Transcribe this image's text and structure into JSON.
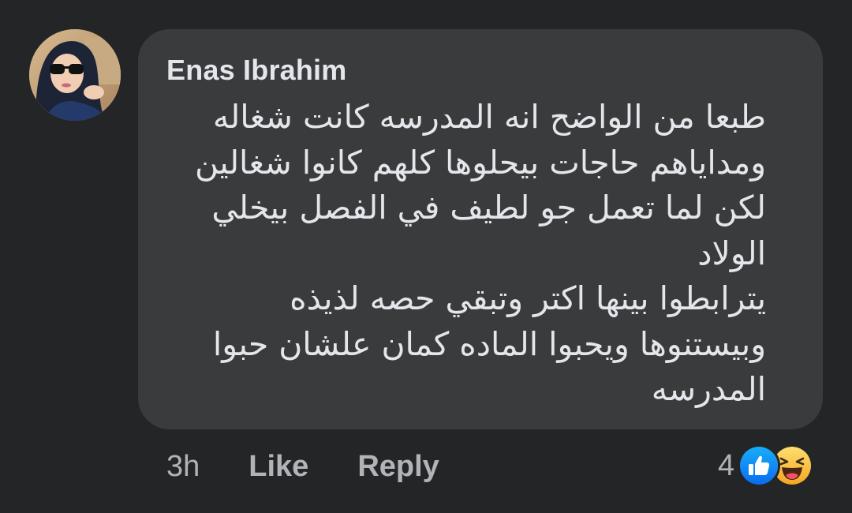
{
  "comment": {
    "author": "Enas Ibrahim",
    "text_lines": [
      "طبعا من الواضح انه المدرسه كانت شغاله",
      "ومداياهم حاجات بيحلوها كلهم كانوا شغالين",
      "لكن لما تعمل جو لطيف في الفصل بيخلي الولاد",
      "يترابطوا بينها اكتر وتبقي حصه لذيذه",
      "وبيستنوها ويحبوا الماده كمان علشان حبوا",
      "المدرسه"
    ]
  },
  "actions": {
    "timestamp": "3h",
    "like_label": "Like",
    "reply_label": "Reply"
  },
  "reactions": {
    "count": "4",
    "icons": [
      "like-reaction-icon",
      "haha-reaction-icon"
    ]
  },
  "colors": {
    "background": "#242526",
    "bubble": "#3a3b3c",
    "primary_text": "#e4e6eb",
    "secondary_text": "#b0b3b8",
    "like_blue": "#1877f2",
    "haha_yellow": "#f7b125"
  }
}
